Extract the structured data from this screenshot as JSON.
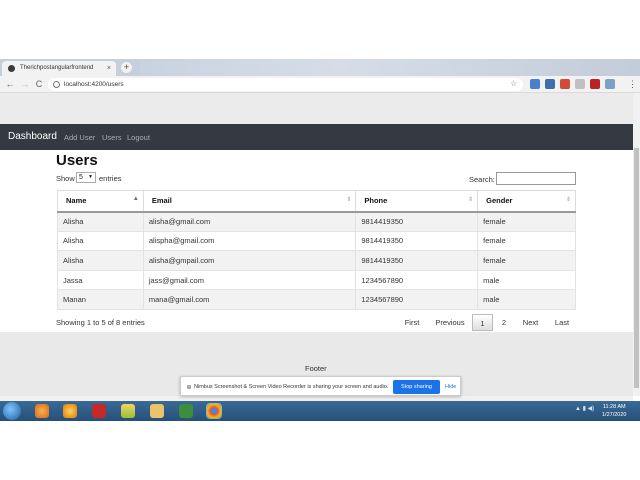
{
  "browser": {
    "tab_title": "Therichpostangularfrontend",
    "new_tab_symbol": "+",
    "tab_close_symbol": "×",
    "url": "localhost:4200/users",
    "back_symbol": "←",
    "forward_symbol": "→",
    "reload_symbol": "C",
    "star_symbol": "☆",
    "menu_symbol": "⋮",
    "extension_colors": [
      "#4a7fd0",
      "#3d6fb0",
      "#d24a3a",
      "#7aa0c8",
      "#c0c0c0",
      "#bb2222",
      "#a33"
    ]
  },
  "navbar": {
    "brand": "Dashboard",
    "links": [
      "Add User",
      "Users",
      "Logout"
    ]
  },
  "page": {
    "title": "Users",
    "show_label": "Show",
    "page_size": "5",
    "entries_label": "entries",
    "search_label": "Search:",
    "search_value": ""
  },
  "table": {
    "columns": [
      "Name",
      "Email",
      "Phone",
      "Gender"
    ],
    "rows": [
      [
        "Alisha",
        "alisha@gmail.com",
        "9814419350",
        "female"
      ],
      [
        "Alisha",
        "alispha@gmail.com",
        "9814419350",
        "female"
      ],
      [
        "Alisha",
        "alisha@gmpail.com",
        "9814419350",
        "female"
      ],
      [
        "Jassa",
        "jass@gmail.com",
        "1234567890",
        "male"
      ],
      [
        "Manan",
        "mana@gmail.com",
        "1234567890",
        "male"
      ]
    ]
  },
  "pagination": {
    "info": "Showing 1 to 5 of 8 entries",
    "first": "First",
    "previous": "Previous",
    "pages": [
      "1",
      "2"
    ],
    "current_page": "1",
    "next": "Next",
    "last": "Last"
  },
  "footer": {
    "text": "Footer"
  },
  "sharing_bar": {
    "message": "Nimbus Screenshot & Screen Video Recorder is sharing your screen and audio.",
    "stop_label": "Stop sharing",
    "hide_label": "Hide"
  },
  "taskbar": {
    "time": "11:28 AM",
    "date": "1/27/2020",
    "tray_text": "▲ ▮ ◀)"
  }
}
